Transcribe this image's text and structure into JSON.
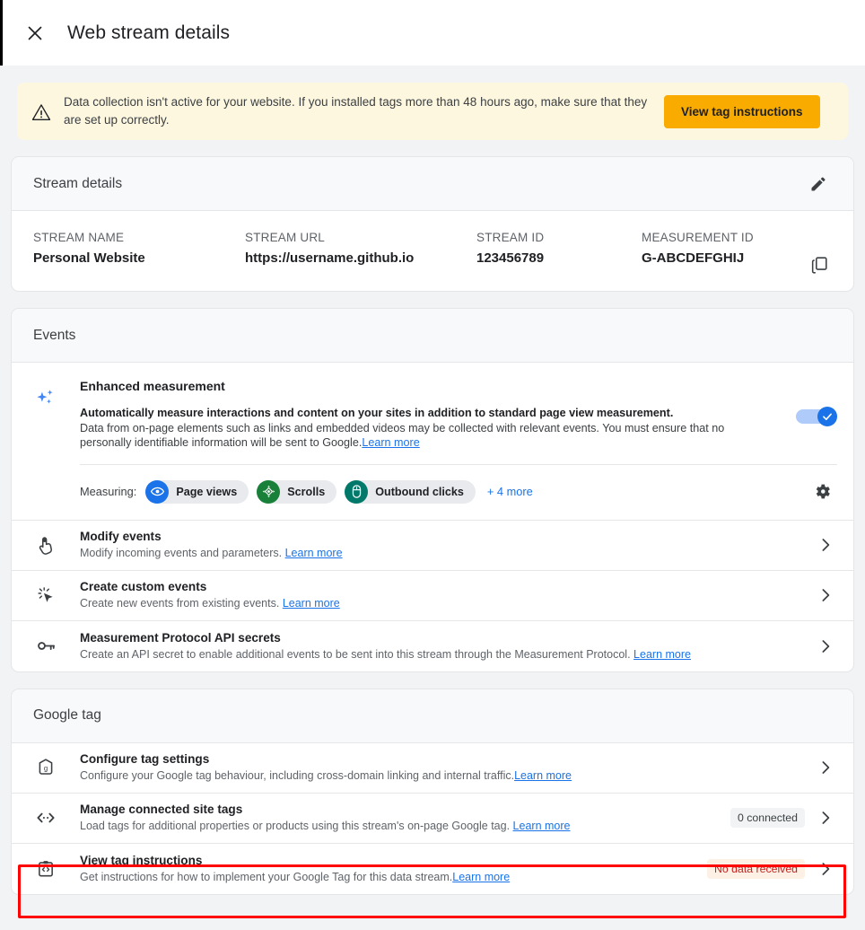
{
  "header": {
    "title": "Web stream details",
    "close_icon": "close-icon"
  },
  "banner": {
    "icon": "warning-triangle-icon",
    "text": "Data collection isn't active for your website. If you installed tags more than 48 hours ago, make sure that they are set up correctly.",
    "button_label": "View tag instructions",
    "button_color": "#f9ab00",
    "background_color": "#fef7e0"
  },
  "stream_details": {
    "section_title": "Stream details",
    "edit_icon": "pencil-edit-icon",
    "copy_icon": "copy-icon",
    "fields": [
      {
        "label": "STREAM NAME",
        "value": "Personal Website"
      },
      {
        "label": "STREAM URL",
        "value": "https://username.github.io"
      },
      {
        "label": "STREAM ID",
        "value": "123456789"
      },
      {
        "label": "MEASUREMENT ID",
        "value": "G-ABCDEFGHIJ"
      }
    ]
  },
  "events": {
    "section_title": "Events",
    "enhanced_measurement": {
      "icon": "sparkle-icon",
      "title": "Enhanced measurement",
      "desc_line1": "Automatically measure interactions and content on your sites in addition to standard page view measurement.",
      "desc_line2": "Data from on-page elements such as links and embedded videos may be collected with relevant events. You must ensure that no",
      "desc_line3": "personally identifiable information will be sent to Google.",
      "learn_more": "Learn more",
      "toggle_on": true,
      "toggle_color": "#1a73e8",
      "measuring_label": "Measuring:",
      "chips": [
        {
          "label": "Page views",
          "icon": "eye-icon",
          "color": "#1a73e8"
        },
        {
          "label": "Scrolls",
          "icon": "scroll-arrows-icon",
          "color": "#188038"
        },
        {
          "label": "Outbound clicks",
          "icon": "mouse-icon",
          "color": "#00796b"
        }
      ],
      "more_label": "+ 4 more",
      "settings_icon": "gear-icon"
    },
    "rows": [
      {
        "icon": "tap-hand-icon",
        "title": "Modify events",
        "desc": "Modify incoming events and parameters.",
        "learn_more": "Learn more",
        "chevron": "chevron-right-icon"
      },
      {
        "icon": "cursor-click-icon",
        "title": "Create custom events",
        "desc": "Create new events from existing events.",
        "learn_more": "Learn more",
        "chevron": "chevron-right-icon"
      },
      {
        "icon": "key-icon",
        "title": "Measurement Protocol API secrets",
        "desc": "Create an API secret to enable additional events to be sent into this stream through the Measurement Protocol.",
        "learn_more": "Learn more",
        "chevron": "chevron-right-icon"
      }
    ]
  },
  "google_tag": {
    "section_title": "Google tag",
    "rows": [
      {
        "icon": "tag-g-icon",
        "title": "Configure tag settings",
        "desc": "Configure your Google tag behaviour, including cross-domain linking and internal traffic.",
        "learn_more": "Learn more",
        "badge": null,
        "chevron": "chevron-right-icon"
      },
      {
        "icon": "code-brackets-icon",
        "title": "Manage connected site tags",
        "desc": "Load tags for additional properties or products using this stream's on-page Google tag.",
        "learn_more": "Learn more",
        "badge": "0 connected",
        "badge_style": "gray",
        "chevron": "chevron-right-icon"
      },
      {
        "icon": "code-clipboard-icon",
        "title": "View tag instructions",
        "desc": "Get instructions for how to implement your Google Tag for this data stream.",
        "learn_more": "Learn more",
        "badge": "No data received",
        "badge_style": "warn",
        "chevron": "chevron-right-icon"
      }
    ]
  },
  "highlight": {
    "color": "#ff0000",
    "target": "view-tag-instructions-row"
  }
}
